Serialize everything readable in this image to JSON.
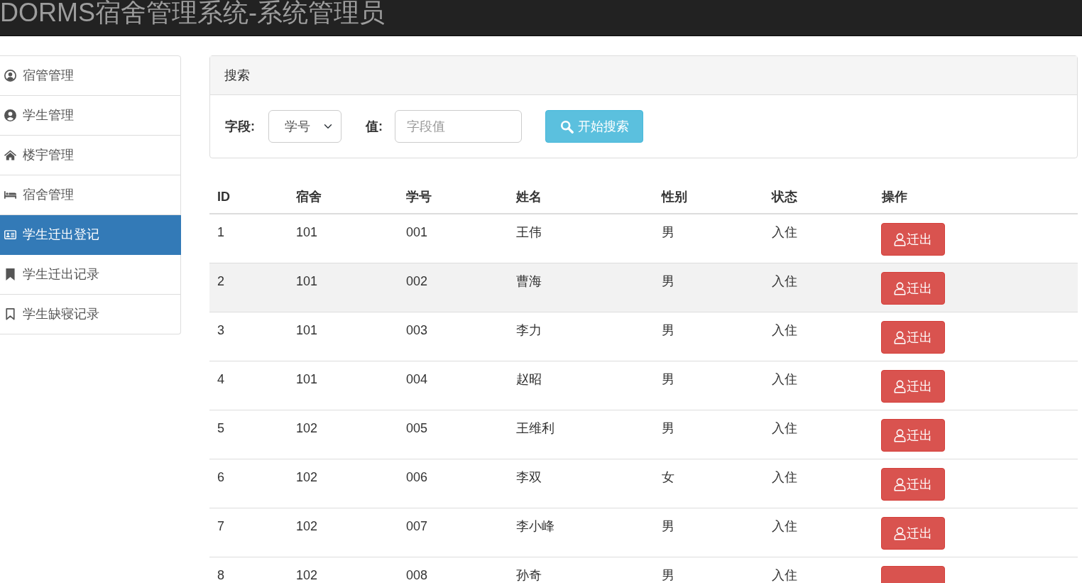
{
  "header": {
    "title": "DORMS宿舍管理系统-系统管理员"
  },
  "sidebar": {
    "items": [
      {
        "label": "宿管管理",
        "selected": false
      },
      {
        "label": "学生管理",
        "selected": false
      },
      {
        "label": "楼宇管理",
        "selected": false
      },
      {
        "label": "宿舍管理",
        "selected": false
      },
      {
        "label": "学生迁出登记",
        "selected": true
      },
      {
        "label": "学生迁出记录",
        "selected": false
      },
      {
        "label": "学生缺寝记录",
        "selected": false
      }
    ]
  },
  "search": {
    "title": "搜索",
    "field_label": "字段:",
    "field_value": "学号",
    "value_label": "值:",
    "value_placeholder": "字段值",
    "button": "开始搜索"
  },
  "table": {
    "columns": [
      "ID",
      "宿舍",
      "学号",
      "姓名",
      "性别",
      "状态",
      "操作"
    ],
    "rows": [
      {
        "cells": [
          "1",
          "101",
          "001",
          "王伟",
          "男",
          "入住"
        ],
        "action": "迁出",
        "hovered": false
      },
      {
        "cells": [
          "2",
          "101",
          "002",
          "曹海",
          "男",
          "入住"
        ],
        "action": "迁出",
        "hovered": true
      },
      {
        "cells": [
          "3",
          "101",
          "003",
          "李力",
          "男",
          "入住"
        ],
        "action": "迁出",
        "hovered": false
      },
      {
        "cells": [
          "4",
          "101",
          "004",
          "赵昭",
          "男",
          "入住"
        ],
        "action": "迁出",
        "hovered": false
      },
      {
        "cells": [
          "5",
          "102",
          "005",
          "王维利",
          "男",
          "入住"
        ],
        "action": "迁出",
        "hovered": false
      },
      {
        "cells": [
          "6",
          "102",
          "006",
          "李双",
          "女",
          "入住"
        ],
        "action": "迁出",
        "hovered": false
      },
      {
        "cells": [
          "7",
          "102",
          "007",
          "李小峰",
          "男",
          "入住"
        ],
        "action": "迁出",
        "hovered": false
      },
      {
        "cells": [
          "8",
          "102",
          "008",
          "孙奇",
          "男",
          "入住"
        ],
        "hovered": false
      }
    ]
  }
}
